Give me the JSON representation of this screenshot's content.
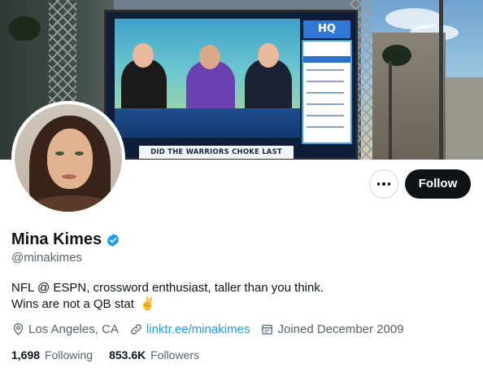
{
  "banner": {
    "badge": "HQ",
    "chyron": "DID THE WARRIORS CHOKE LAST NIGHT?"
  },
  "actions": {
    "more_icon": "ellipsis-icon",
    "follow_label": "Follow"
  },
  "profile": {
    "name": "Mina Kimes",
    "verified_icon": "verified-badge-icon",
    "handle": "@minakimes",
    "bio_line1": "NFL @ ESPN, crossword enthusiast, taller than you think.",
    "bio_line2": "Wins are not a QB stat",
    "bio_emoji": "✌"
  },
  "meta": {
    "location": "Los Angeles, CA",
    "website": "linktr.ee/minakimes",
    "joined": "Joined December 2009"
  },
  "stats": {
    "following_count": "1,698",
    "following_label": "Following",
    "followers_count": "853.6K",
    "followers_label": "Followers"
  },
  "colors": {
    "accent": "#1d9bf0",
    "text_primary": "#0f1419",
    "text_secondary": "#536471"
  }
}
